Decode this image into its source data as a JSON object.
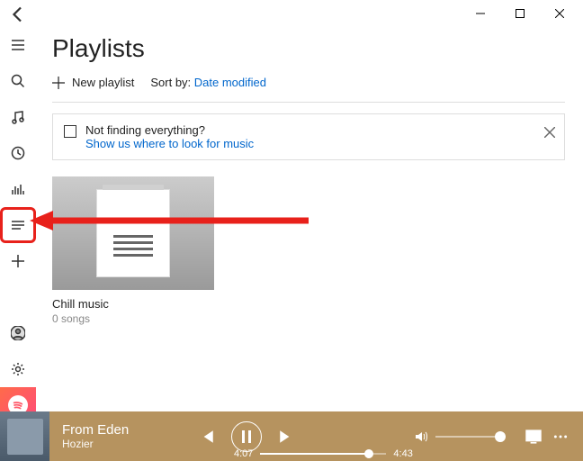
{
  "header": {
    "title": "Playlists"
  },
  "toolbar": {
    "new_label": "New playlist",
    "sort_prefix": "Sort by:",
    "sort_value": "Date modified"
  },
  "infobox": {
    "line1": "Not finding everything?",
    "link": "Show us where to look for music"
  },
  "playlists": [
    {
      "name": "Chill music",
      "sub": "0 songs"
    }
  ],
  "player": {
    "track": "From Eden",
    "artist": "Hozier",
    "elapsed": "4:07",
    "duration": "4:43"
  }
}
